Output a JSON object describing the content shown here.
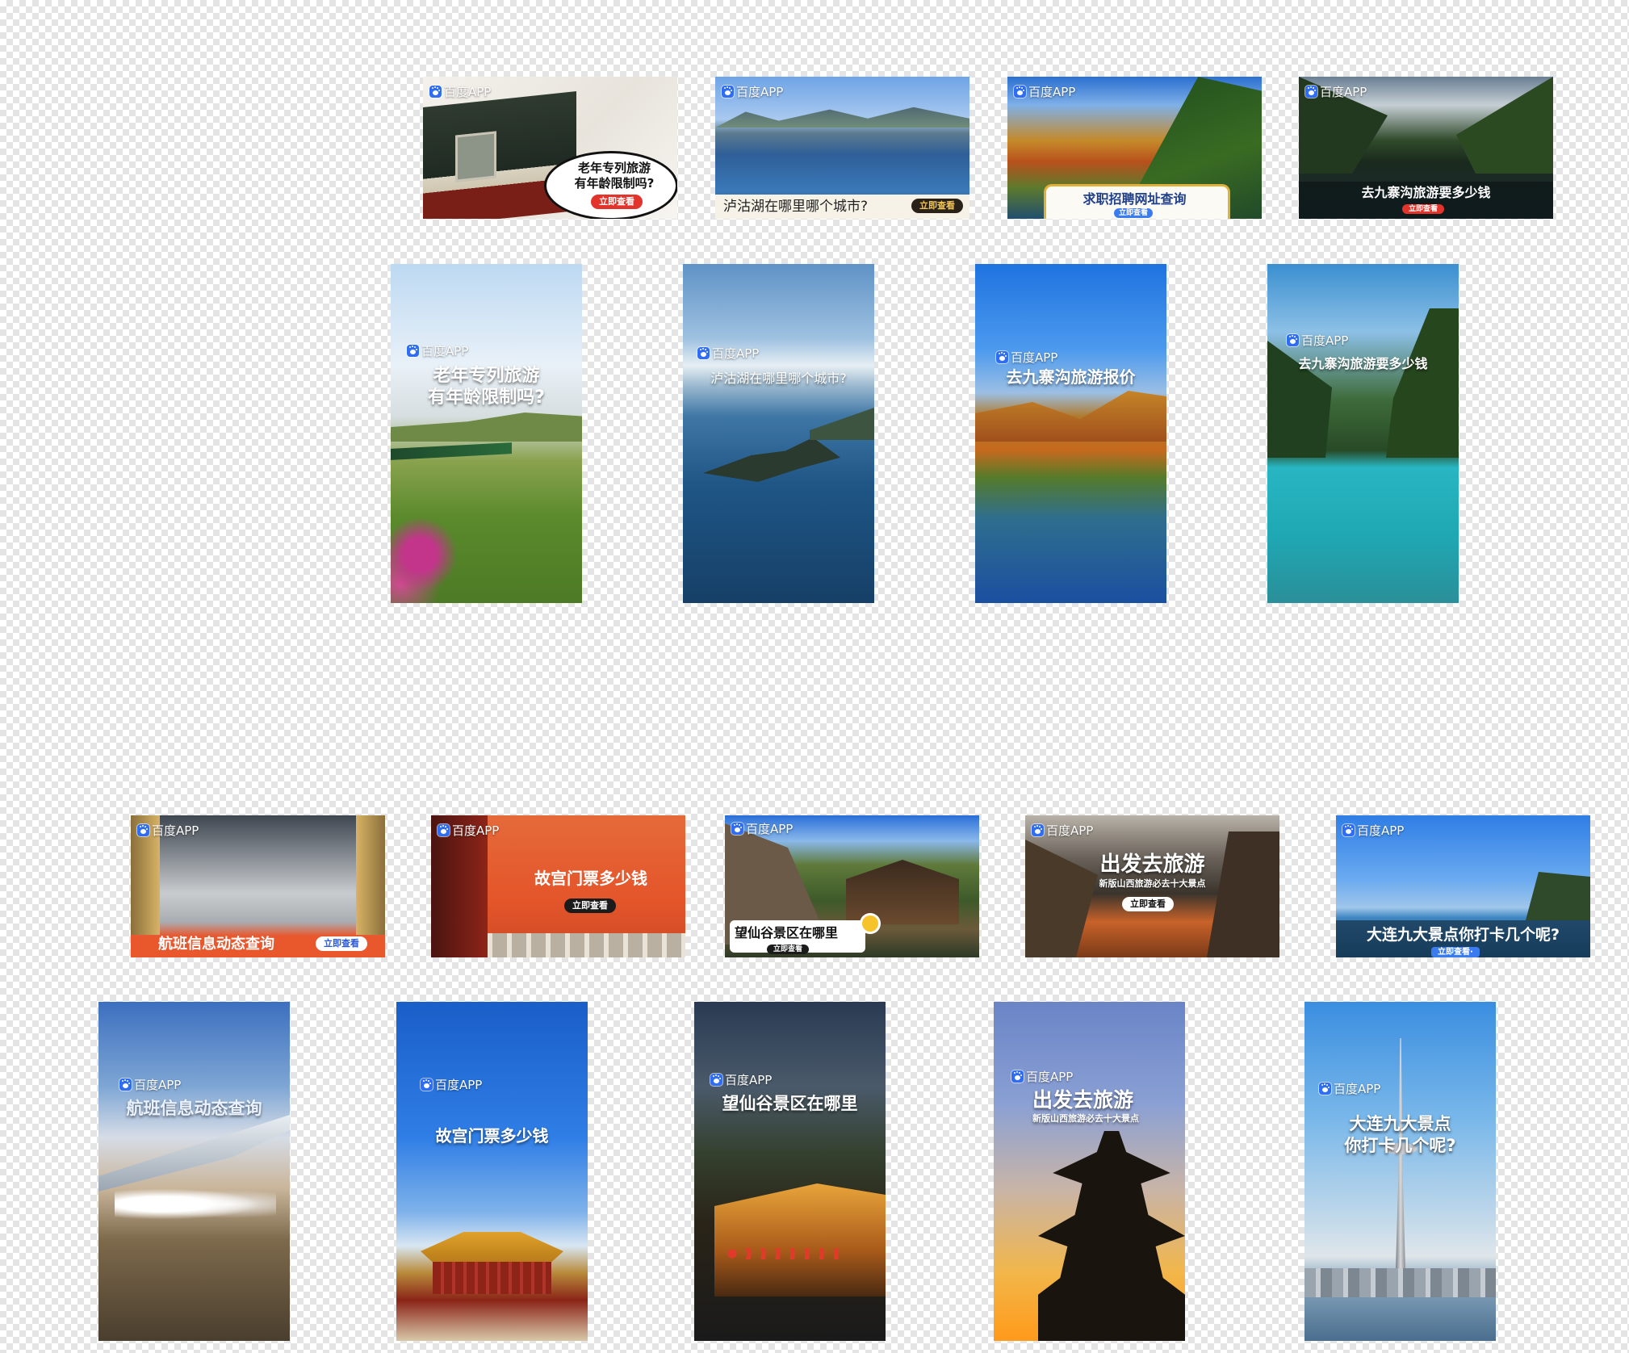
{
  "brand": "百度APP",
  "cta": "立即查看",
  "row1": [
    {
      "title": "老年专列旅游\n有年龄限制吗?",
      "cta": "立即查看"
    },
    {
      "title": "泸沽湖在哪里哪个城市?",
      "cta": "立即查看"
    },
    {
      "title": "求职招聘网址查询",
      "cta": "立即查看"
    },
    {
      "title": "去九寨沟旅游要多少钱",
      "cta": "立即查看"
    }
  ],
  "row2": [
    {
      "title": "老年专列旅游\n有年龄限制吗?"
    },
    {
      "title": "泸沽湖在哪里哪个城市?"
    },
    {
      "title": "去九寨沟旅游报价"
    },
    {
      "title": "去九寨沟旅游要多少钱"
    }
  ],
  "row3": [
    {
      "title": "航班信息动态查询",
      "cta": "立即查看"
    },
    {
      "title": "故宫门票多少钱",
      "cta": "立即查看"
    },
    {
      "title": "望仙谷景区在哪里",
      "cta": "立即查看"
    },
    {
      "title": "出发去旅游",
      "subtitle": "新版山西旅游必去十大景点",
      "cta": "立即查看"
    },
    {
      "title": "大连九大景点你打卡几个呢?",
      "cta": "立即查看·"
    }
  ],
  "row4": [
    {
      "title": "航班信息动态查询"
    },
    {
      "title": "故宫门票多少钱"
    },
    {
      "title": "望仙谷景区在哪里"
    },
    {
      "title": "出发去旅游",
      "subtitle": "新版山西旅游必去十大景点"
    },
    {
      "title": "大连九大景点\n你打卡几个呢?"
    }
  ]
}
